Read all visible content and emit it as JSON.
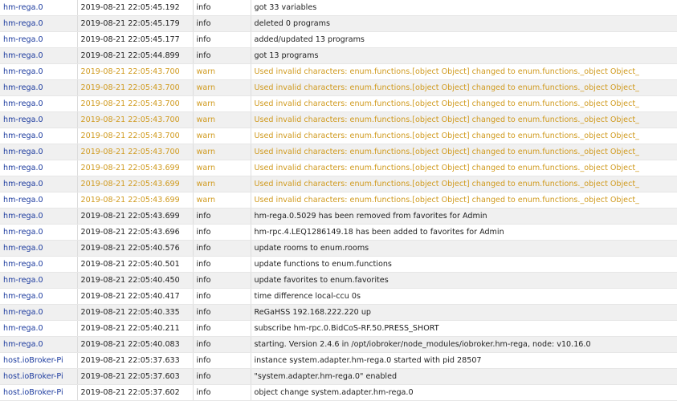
{
  "colors": {
    "source": "#1b3a9e",
    "info_text": "#222222",
    "warn_text": "#d09a1e",
    "row_alt": "#f0f0f0"
  },
  "log": {
    "entries": [
      {
        "source": "hm-rega.0",
        "time": "2019-08-21 22:05:45.192",
        "severity": "info",
        "message": "got 33 variables"
      },
      {
        "source": "hm-rega.0",
        "time": "2019-08-21 22:05:45.179",
        "severity": "info",
        "message": "deleted 0 programs"
      },
      {
        "source": "hm-rega.0",
        "time": "2019-08-21 22:05:45.177",
        "severity": "info",
        "message": "added/updated 13 programs"
      },
      {
        "source": "hm-rega.0",
        "time": "2019-08-21 22:05:44.899",
        "severity": "info",
        "message": "got 13 programs"
      },
      {
        "source": "hm-rega.0",
        "time": "2019-08-21 22:05:43.700",
        "severity": "warn",
        "message": "Used invalid characters: enum.functions.[object Object] changed to enum.functions._object Object_"
      },
      {
        "source": "hm-rega.0",
        "time": "2019-08-21 22:05:43.700",
        "severity": "warn",
        "message": "Used invalid characters: enum.functions.[object Object] changed to enum.functions._object Object_"
      },
      {
        "source": "hm-rega.0",
        "time": "2019-08-21 22:05:43.700",
        "severity": "warn",
        "message": "Used invalid characters: enum.functions.[object Object] changed to enum.functions._object Object_"
      },
      {
        "source": "hm-rega.0",
        "time": "2019-08-21 22:05:43.700",
        "severity": "warn",
        "message": "Used invalid characters: enum.functions.[object Object] changed to enum.functions._object Object_"
      },
      {
        "source": "hm-rega.0",
        "time": "2019-08-21 22:05:43.700",
        "severity": "warn",
        "message": "Used invalid characters: enum.functions.[object Object] changed to enum.functions._object Object_"
      },
      {
        "source": "hm-rega.0",
        "time": "2019-08-21 22:05:43.700",
        "severity": "warn",
        "message": "Used invalid characters: enum.functions.[object Object] changed to enum.functions._object Object_"
      },
      {
        "source": "hm-rega.0",
        "time": "2019-08-21 22:05:43.699",
        "severity": "warn",
        "message": "Used invalid characters: enum.functions.[object Object] changed to enum.functions._object Object_"
      },
      {
        "source": "hm-rega.0",
        "time": "2019-08-21 22:05:43.699",
        "severity": "warn",
        "message": "Used invalid characters: enum.functions.[object Object] changed to enum.functions._object Object_"
      },
      {
        "source": "hm-rega.0",
        "time": "2019-08-21 22:05:43.699",
        "severity": "warn",
        "message": "Used invalid characters: enum.functions.[object Object] changed to enum.functions._object Object_"
      },
      {
        "source": "hm-rega.0",
        "time": "2019-08-21 22:05:43.699",
        "severity": "info",
        "message": "hm-rega.0.5029 has been removed from favorites for Admin"
      },
      {
        "source": "hm-rega.0",
        "time": "2019-08-21 22:05:43.696",
        "severity": "info",
        "message": "hm-rpc.4.LEQ1286149.18 has been added to favorites for Admin"
      },
      {
        "source": "hm-rega.0",
        "time": "2019-08-21 22:05:40.576",
        "severity": "info",
        "message": "update rooms to enum.rooms"
      },
      {
        "source": "hm-rega.0",
        "time": "2019-08-21 22:05:40.501",
        "severity": "info",
        "message": "update functions to enum.functions"
      },
      {
        "source": "hm-rega.0",
        "time": "2019-08-21 22:05:40.450",
        "severity": "info",
        "message": "update favorites to enum.favorites"
      },
      {
        "source": "hm-rega.0",
        "time": "2019-08-21 22:05:40.417",
        "severity": "info",
        "message": "time difference local-ccu 0s"
      },
      {
        "source": "hm-rega.0",
        "time": "2019-08-21 22:05:40.335",
        "severity": "info",
        "message": "ReGaHSS 192.168.222.220 up"
      },
      {
        "source": "hm-rega.0",
        "time": "2019-08-21 22:05:40.211",
        "severity": "info",
        "message": "subscribe hm-rpc.0.BidCoS-RF.50.PRESS_SHORT"
      },
      {
        "source": "hm-rega.0",
        "time": "2019-08-21 22:05:40.083",
        "severity": "info",
        "message": "starting. Version 2.4.6 in /opt/iobroker/node_modules/iobroker.hm-rega, node: v10.16.0"
      },
      {
        "source": "host.ioBroker-Pi",
        "time": "2019-08-21 22:05:37.633",
        "severity": "info",
        "message": "instance system.adapter.hm-rega.0 started with pid 28507"
      },
      {
        "source": "host.ioBroker-Pi",
        "time": "2019-08-21 22:05:37.603",
        "severity": "info",
        "message": "\"system.adapter.hm-rega.0\" enabled"
      },
      {
        "source": "host.ioBroker-Pi",
        "time": "2019-08-21 22:05:37.602",
        "severity": "info",
        "message": "object change system.adapter.hm-rega.0"
      }
    ]
  }
}
